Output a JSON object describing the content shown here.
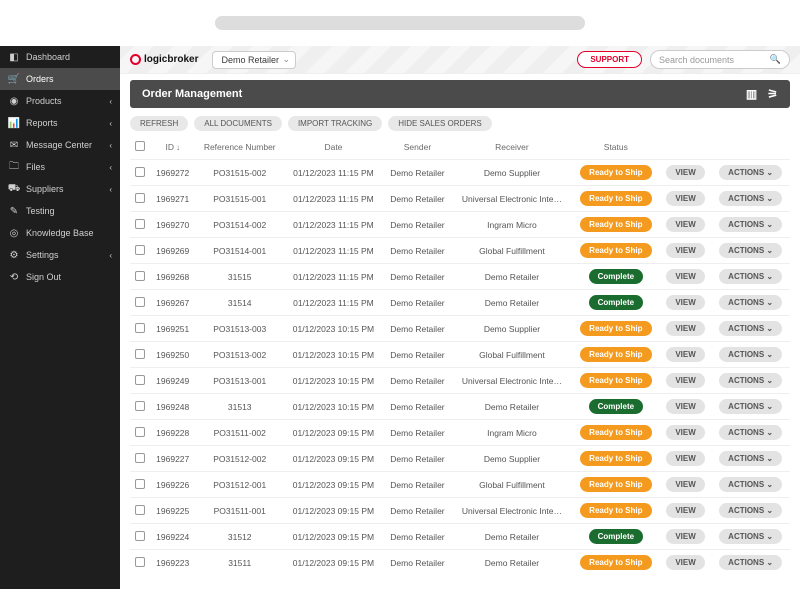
{
  "browser": {},
  "logo": {
    "text": "logicbroker"
  },
  "tenant": {
    "selected": "Demo Retailer"
  },
  "support": {
    "label": "SUPPORT"
  },
  "search": {
    "placeholder": "Search documents"
  },
  "sidebar": {
    "items": [
      {
        "label": "Dashboard",
        "icon": "◧",
        "chev": false,
        "active": false
      },
      {
        "label": "Orders",
        "icon": "🛒",
        "chev": false,
        "active": true
      },
      {
        "label": "Products",
        "icon": "◉",
        "chev": true,
        "active": false
      },
      {
        "label": "Reports",
        "icon": "📊",
        "chev": true,
        "active": false
      },
      {
        "label": "Message Center",
        "icon": "✉",
        "chev": true,
        "active": false
      },
      {
        "label": "Files",
        "icon": "🗀",
        "chev": true,
        "active": false
      },
      {
        "label": "Suppliers",
        "icon": "⛟",
        "chev": true,
        "active": false
      },
      {
        "label": "Testing",
        "icon": "✎",
        "chev": false,
        "active": false
      },
      {
        "label": "Knowledge Base",
        "icon": "◎",
        "chev": false,
        "active": false
      },
      {
        "label": "Settings",
        "icon": "⚙",
        "chev": true,
        "active": false
      },
      {
        "label": "Sign Out",
        "icon": "⟲",
        "chev": false,
        "active": false
      }
    ]
  },
  "banner": {
    "title": "Order Management"
  },
  "filters": {
    "refresh": "REFRESH",
    "all_docs": "ALL DOCUMENTS",
    "import_tracking": "IMPORT TRACKING",
    "hide_sales": "HIDE SALES ORDERS"
  },
  "table": {
    "headers": {
      "id": "ID",
      "ref": "Reference Number",
      "date": "Date",
      "sender": "Sender",
      "receiver": "Receiver",
      "status": "Status"
    },
    "view_label": "VIEW",
    "actions_label": "ACTIONS",
    "rows": [
      {
        "id": "1969272",
        "ref": "PO31515-002",
        "date": "01/12/2023 11:15 PM",
        "sender": "Demo Retailer",
        "receiver": "Demo Supplier",
        "status": "Ready to Ship"
      },
      {
        "id": "1969271",
        "ref": "PO31515-001",
        "date": "01/12/2023 11:15 PM",
        "sender": "Demo Retailer",
        "receiver": "Universal Electronic Inte…",
        "status": "Ready to Ship"
      },
      {
        "id": "1969270",
        "ref": "PO31514-002",
        "date": "01/12/2023 11:15 PM",
        "sender": "Demo Retailer",
        "receiver": "Ingram Micro",
        "status": "Ready to Ship"
      },
      {
        "id": "1969269",
        "ref": "PO31514-001",
        "date": "01/12/2023 11:15 PM",
        "sender": "Demo Retailer",
        "receiver": "Global Fulfillment",
        "status": "Ready to Ship"
      },
      {
        "id": "1969268",
        "ref": "31515",
        "date": "01/12/2023 11:15 PM",
        "sender": "Demo Retailer",
        "receiver": "Demo Retailer",
        "status": "Complete"
      },
      {
        "id": "1969267",
        "ref": "31514",
        "date": "01/12/2023 11:15 PM",
        "sender": "Demo Retailer",
        "receiver": "Demo Retailer",
        "status": "Complete"
      },
      {
        "id": "1969251",
        "ref": "PO31513-003",
        "date": "01/12/2023 10:15 PM",
        "sender": "Demo Retailer",
        "receiver": "Demo Supplier",
        "status": "Ready to Ship"
      },
      {
        "id": "1969250",
        "ref": "PO31513-002",
        "date": "01/12/2023 10:15 PM",
        "sender": "Demo Retailer",
        "receiver": "Global Fulfillment",
        "status": "Ready to Ship"
      },
      {
        "id": "1969249",
        "ref": "PO31513-001",
        "date": "01/12/2023 10:15 PM",
        "sender": "Demo Retailer",
        "receiver": "Universal Electronic Inte…",
        "status": "Ready to Ship"
      },
      {
        "id": "1969248",
        "ref": "31513",
        "date": "01/12/2023 10:15 PM",
        "sender": "Demo Retailer",
        "receiver": "Demo Retailer",
        "status": "Complete"
      },
      {
        "id": "1969228",
        "ref": "PO31511-002",
        "date": "01/12/2023 09:15 PM",
        "sender": "Demo Retailer",
        "receiver": "Ingram Micro",
        "status": "Ready to Ship"
      },
      {
        "id": "1969227",
        "ref": "PO31512-002",
        "date": "01/12/2023 09:15 PM",
        "sender": "Demo Retailer",
        "receiver": "Demo Supplier",
        "status": "Ready to Ship"
      },
      {
        "id": "1969226",
        "ref": "PO31512-001",
        "date": "01/12/2023 09:15 PM",
        "sender": "Demo Retailer",
        "receiver": "Global Fulfillment",
        "status": "Ready to Ship"
      },
      {
        "id": "1969225",
        "ref": "PO31511-001",
        "date": "01/12/2023 09:15 PM",
        "sender": "Demo Retailer",
        "receiver": "Universal Electronic Inte…",
        "status": "Ready to Ship"
      },
      {
        "id": "1969224",
        "ref": "31512",
        "date": "01/12/2023 09:15 PM",
        "sender": "Demo Retailer",
        "receiver": "Demo Retailer",
        "status": "Complete"
      },
      {
        "id": "1969223",
        "ref": "31511",
        "date": "01/12/2023 09:15 PM",
        "sender": "Demo Retailer",
        "receiver": "Demo Retailer",
        "status": "Ready to Ship"
      }
    ]
  }
}
